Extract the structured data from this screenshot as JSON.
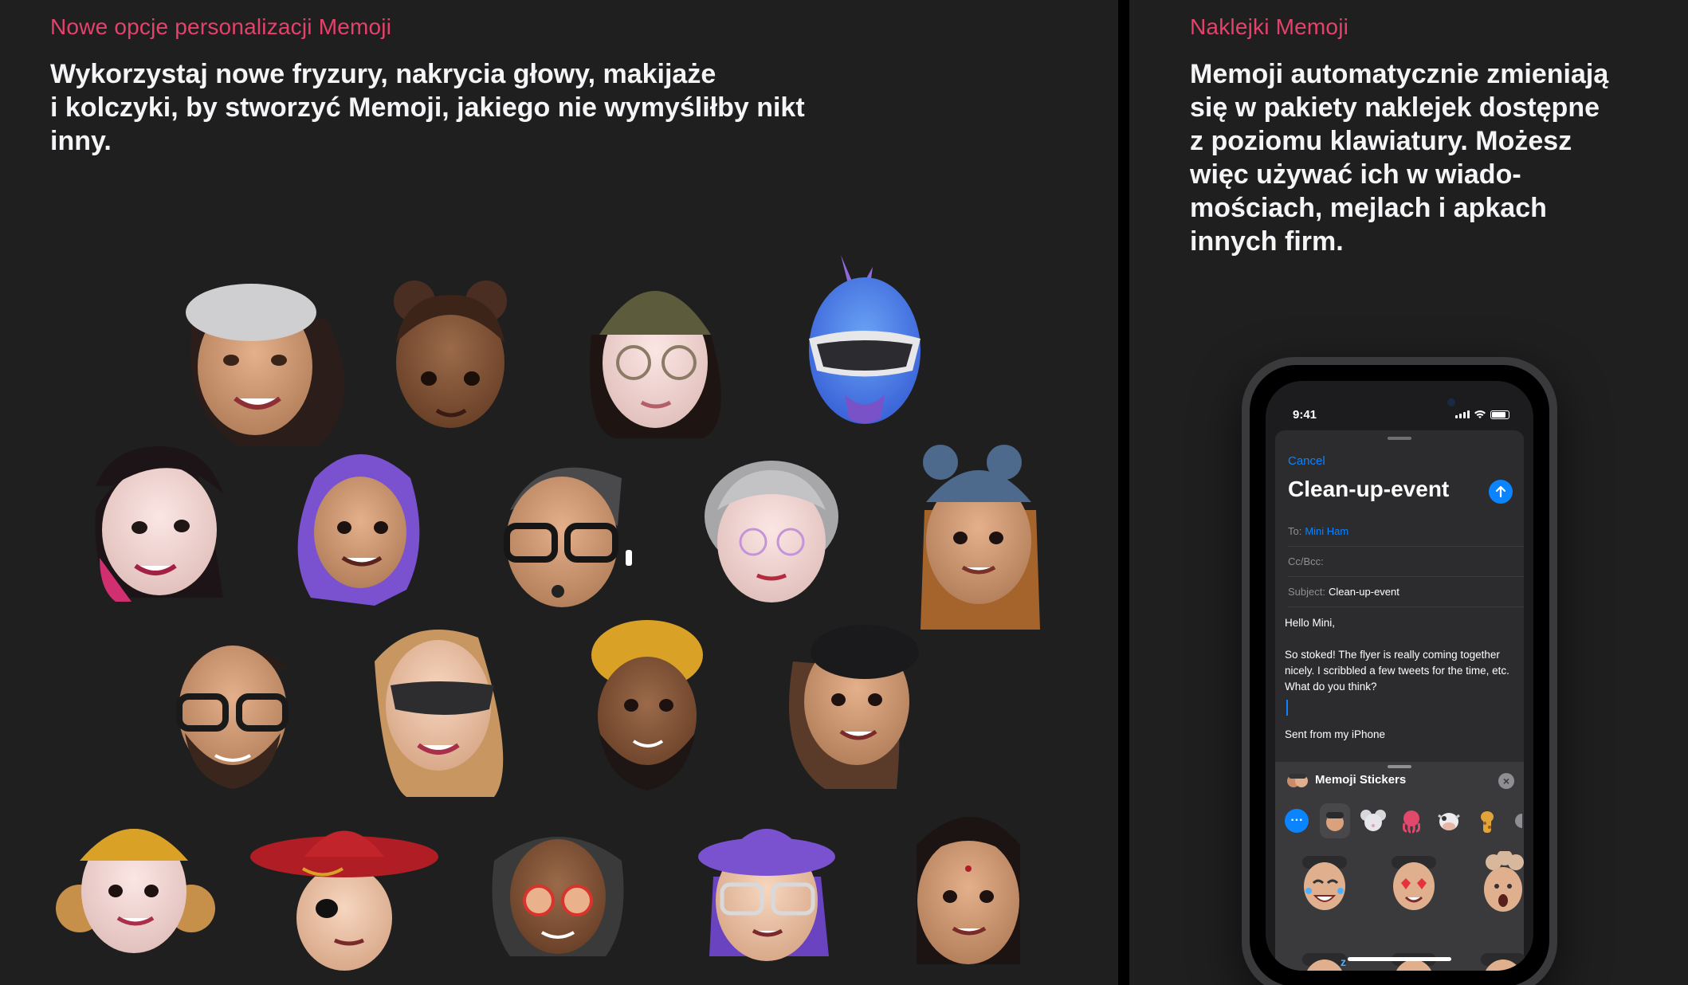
{
  "left_panel": {
    "eyebrow": "Nowe opcje personalizacji Memoji",
    "headline_lines": [
      "Wykorzystaj nowe fryzury, nakrycia głowy, makijaże",
      "i kolczyki, by stworzyć Memoji, jakiego nie wymyśliłby nikt",
      "inny."
    ]
  },
  "right_panel": {
    "eyebrow": "Naklejki Memoji",
    "headline_lines": [
      "Memoji automatycznie zmieniają",
      "się w pakiety naklejek dostępne",
      "z poziomu klawiatury. Możesz",
      "więc używać ich w wiado-",
      "mościach, mejlach i apkach",
      "innych firm."
    ]
  },
  "phone": {
    "status_time": "9:41",
    "mail": {
      "cancel_label": "Cancel",
      "title": "Clean-up-event",
      "to_label": "To:",
      "to_value": "Mini Ham",
      "ccbcc_label": "Cc/Bcc:",
      "subject_label": "Subject:",
      "subject_value": "Clean-up-event",
      "greeting": "Hello Mini,",
      "body_lines": [
        "So stoked! The flyer is really coming together",
        "nicely. I scribbled a few tweets for the time, etc.",
        "What do you think?"
      ],
      "signature": "Sent from my iPhone"
    },
    "sticker_tray": {
      "title": "Memoji Stickers",
      "categories": [
        "more-icon",
        "memoji-avatar",
        "mouse-icon",
        "octopus-icon",
        "cow-icon",
        "giraffe-icon",
        "more-partial"
      ],
      "stickers": [
        "crying-laughing",
        "heart-eyes",
        "mind-blown",
        "sleeping",
        "neutral",
        "thinking"
      ]
    }
  },
  "colors": {
    "background": "#1f1f20",
    "accent_pink": "#e6416a",
    "ios_blue": "#0a84ff"
  },
  "memoji_faces": [
    "beret-woman",
    "buns-girl",
    "beanie-glasses-woman",
    "blue-mohawk-sunglasses",
    "pink-hair-piercing",
    "purple-hijab-woman",
    "glasses-airpods-man",
    "gray-hair-grandma",
    "bear-ears-beanie-girl",
    "beard-glasses-man",
    "sunglasses-blonde-woman",
    "yellow-turban-man",
    "black-beret-woman",
    "yellow-beanie-curly",
    "sombrero-eyepatch",
    "dreadlocks-red-glasses",
    "purple-hat-glasses-woman",
    "bindi-woman"
  ]
}
